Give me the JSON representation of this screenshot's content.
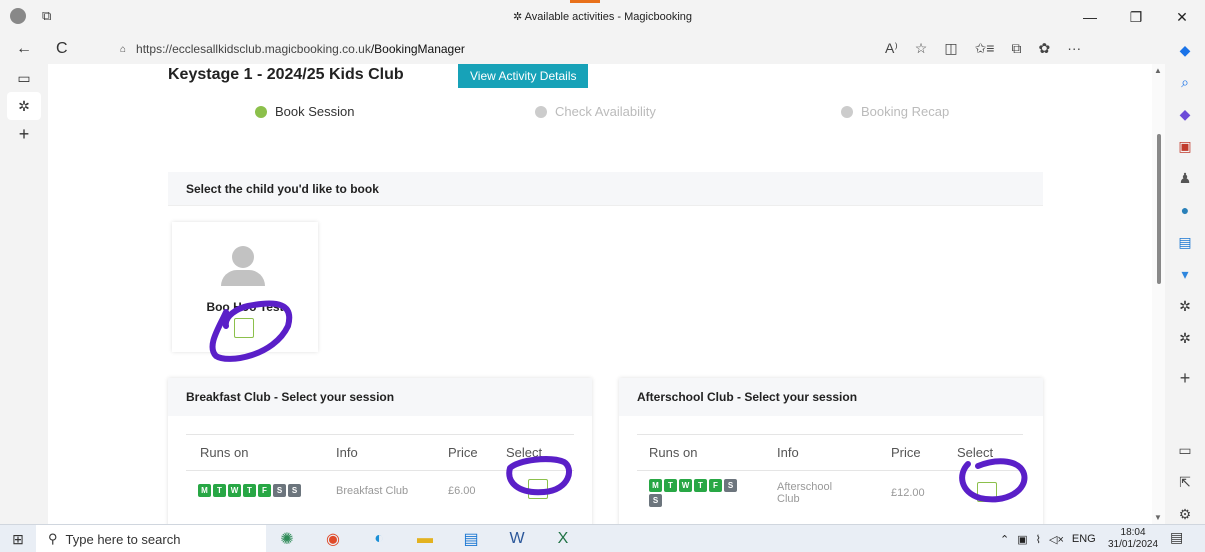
{
  "window": {
    "title": "Available activities - Magicbooking",
    "minimize": "—",
    "restore": "❐",
    "close": "✕"
  },
  "browser": {
    "url_host": "https://ecclesallkidsclub.magicbooking.co.uk",
    "url_path": "/BookingManager",
    "back_icon": "←",
    "refresh_icon": "C",
    "lock_icon": "🔒",
    "tools": [
      "A⁾",
      "☆",
      "◫",
      "✩≡",
      "⧉",
      "✿",
      "···"
    ]
  },
  "page": {
    "heading": "Keystage 1 - 2024/25 Kids Club",
    "view_button": "View Activity Details",
    "steps": [
      {
        "label": "Book Session",
        "state": "active"
      },
      {
        "label": "Check Availability",
        "state": "inactive"
      },
      {
        "label": "Booking Recap",
        "state": "inactive"
      }
    ],
    "select_child_heading": "Select the child you'd like to book",
    "child_name": "Boo Hoo Test"
  },
  "breakfast": {
    "heading": "Breakfast Club - Select your session",
    "col_runs": "Runs on",
    "col_info": "Info",
    "col_price": "Price",
    "col_select": "Select",
    "info": "Breakfast Club",
    "price": "£6.00",
    "days": [
      "M",
      "T",
      "W",
      "T",
      "F",
      "S",
      "S"
    ]
  },
  "afterschool": {
    "heading": "Afterschool Club - Select your session",
    "col_runs": "Runs on",
    "col_info": "Info",
    "col_price": "Price",
    "col_select": "Select",
    "info": "Afterschool Club",
    "price": "£12.00",
    "days": [
      "M",
      "T",
      "W",
      "T",
      "F",
      "S",
      "S"
    ]
  },
  "taskbar": {
    "search_placeholder": "Type here to search",
    "lang": "ENG",
    "time": "18:04",
    "date": "31/01/2024"
  },
  "colors": {
    "accent": "#17a2b8",
    "active_step": "#8cc04b",
    "inactive_step": "#cccccc",
    "day_on": "#28a745",
    "day_off": "#6c757d",
    "annotation": "#5a1fc8"
  }
}
